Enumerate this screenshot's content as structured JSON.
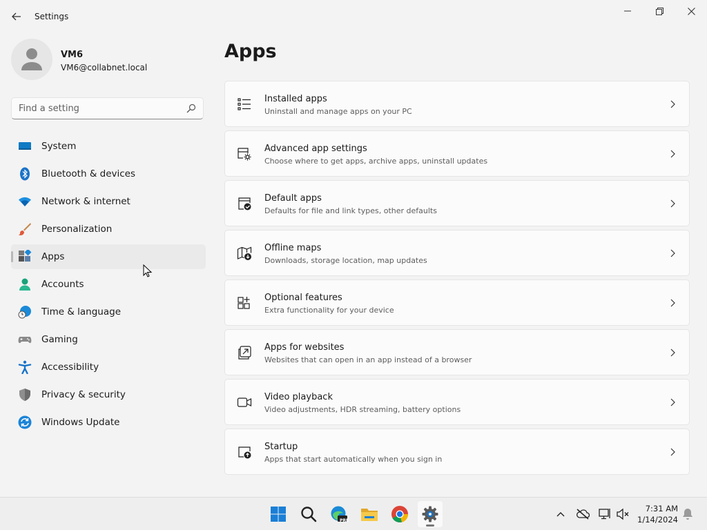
{
  "window": {
    "title": "Settings"
  },
  "profile": {
    "name": "VM6",
    "email": "VM6@collabnet.local"
  },
  "search": {
    "placeholder": "Find a setting"
  },
  "sidebar": {
    "items": [
      {
        "label": "System",
        "icon": "system-icon"
      },
      {
        "label": "Bluetooth & devices",
        "icon": "bluetooth-icon"
      },
      {
        "label": "Network & internet",
        "icon": "wifi-icon"
      },
      {
        "label": "Personalization",
        "icon": "brush-icon"
      },
      {
        "label": "Apps",
        "icon": "apps-icon",
        "selected": true
      },
      {
        "label": "Accounts",
        "icon": "accounts-icon"
      },
      {
        "label": "Time & language",
        "icon": "globe-clock-icon"
      },
      {
        "label": "Gaming",
        "icon": "gamepad-icon"
      },
      {
        "label": "Accessibility",
        "icon": "accessibility-icon"
      },
      {
        "label": "Privacy & security",
        "icon": "shield-icon"
      },
      {
        "label": "Windows Update",
        "icon": "update-icon"
      }
    ]
  },
  "main": {
    "title": "Apps",
    "cards": [
      {
        "title": "Installed apps",
        "subtitle": "Uninstall and manage apps on your PC",
        "icon": "list-icon"
      },
      {
        "title": "Advanced app settings",
        "subtitle": "Choose where to get apps, archive apps, uninstall updates",
        "icon": "app-settings-icon"
      },
      {
        "title": "Default apps",
        "subtitle": "Defaults for file and link types, other defaults",
        "icon": "default-apps-icon"
      },
      {
        "title": "Offline maps",
        "subtitle": "Downloads, storage location, map updates",
        "icon": "map-download-icon"
      },
      {
        "title": "Optional features",
        "subtitle": "Extra functionality for your device",
        "icon": "grid-add-icon"
      },
      {
        "title": "Apps for websites",
        "subtitle": "Websites that can open in an app instead of a browser",
        "icon": "open-in-app-icon"
      },
      {
        "title": "Video playback",
        "subtitle": "Video adjustments, HDR streaming, battery options",
        "icon": "video-icon"
      },
      {
        "title": "Startup",
        "subtitle": "Apps that start automatically when you sign in",
        "icon": "startup-icon"
      }
    ]
  },
  "taskbar": {
    "edge_badge": "PRE",
    "time": "7:31 AM",
    "date": "1/14/2024"
  },
  "colors": {
    "accent": "#0067c0",
    "background": "#f3f3f3",
    "card": "#fbfbfb"
  }
}
